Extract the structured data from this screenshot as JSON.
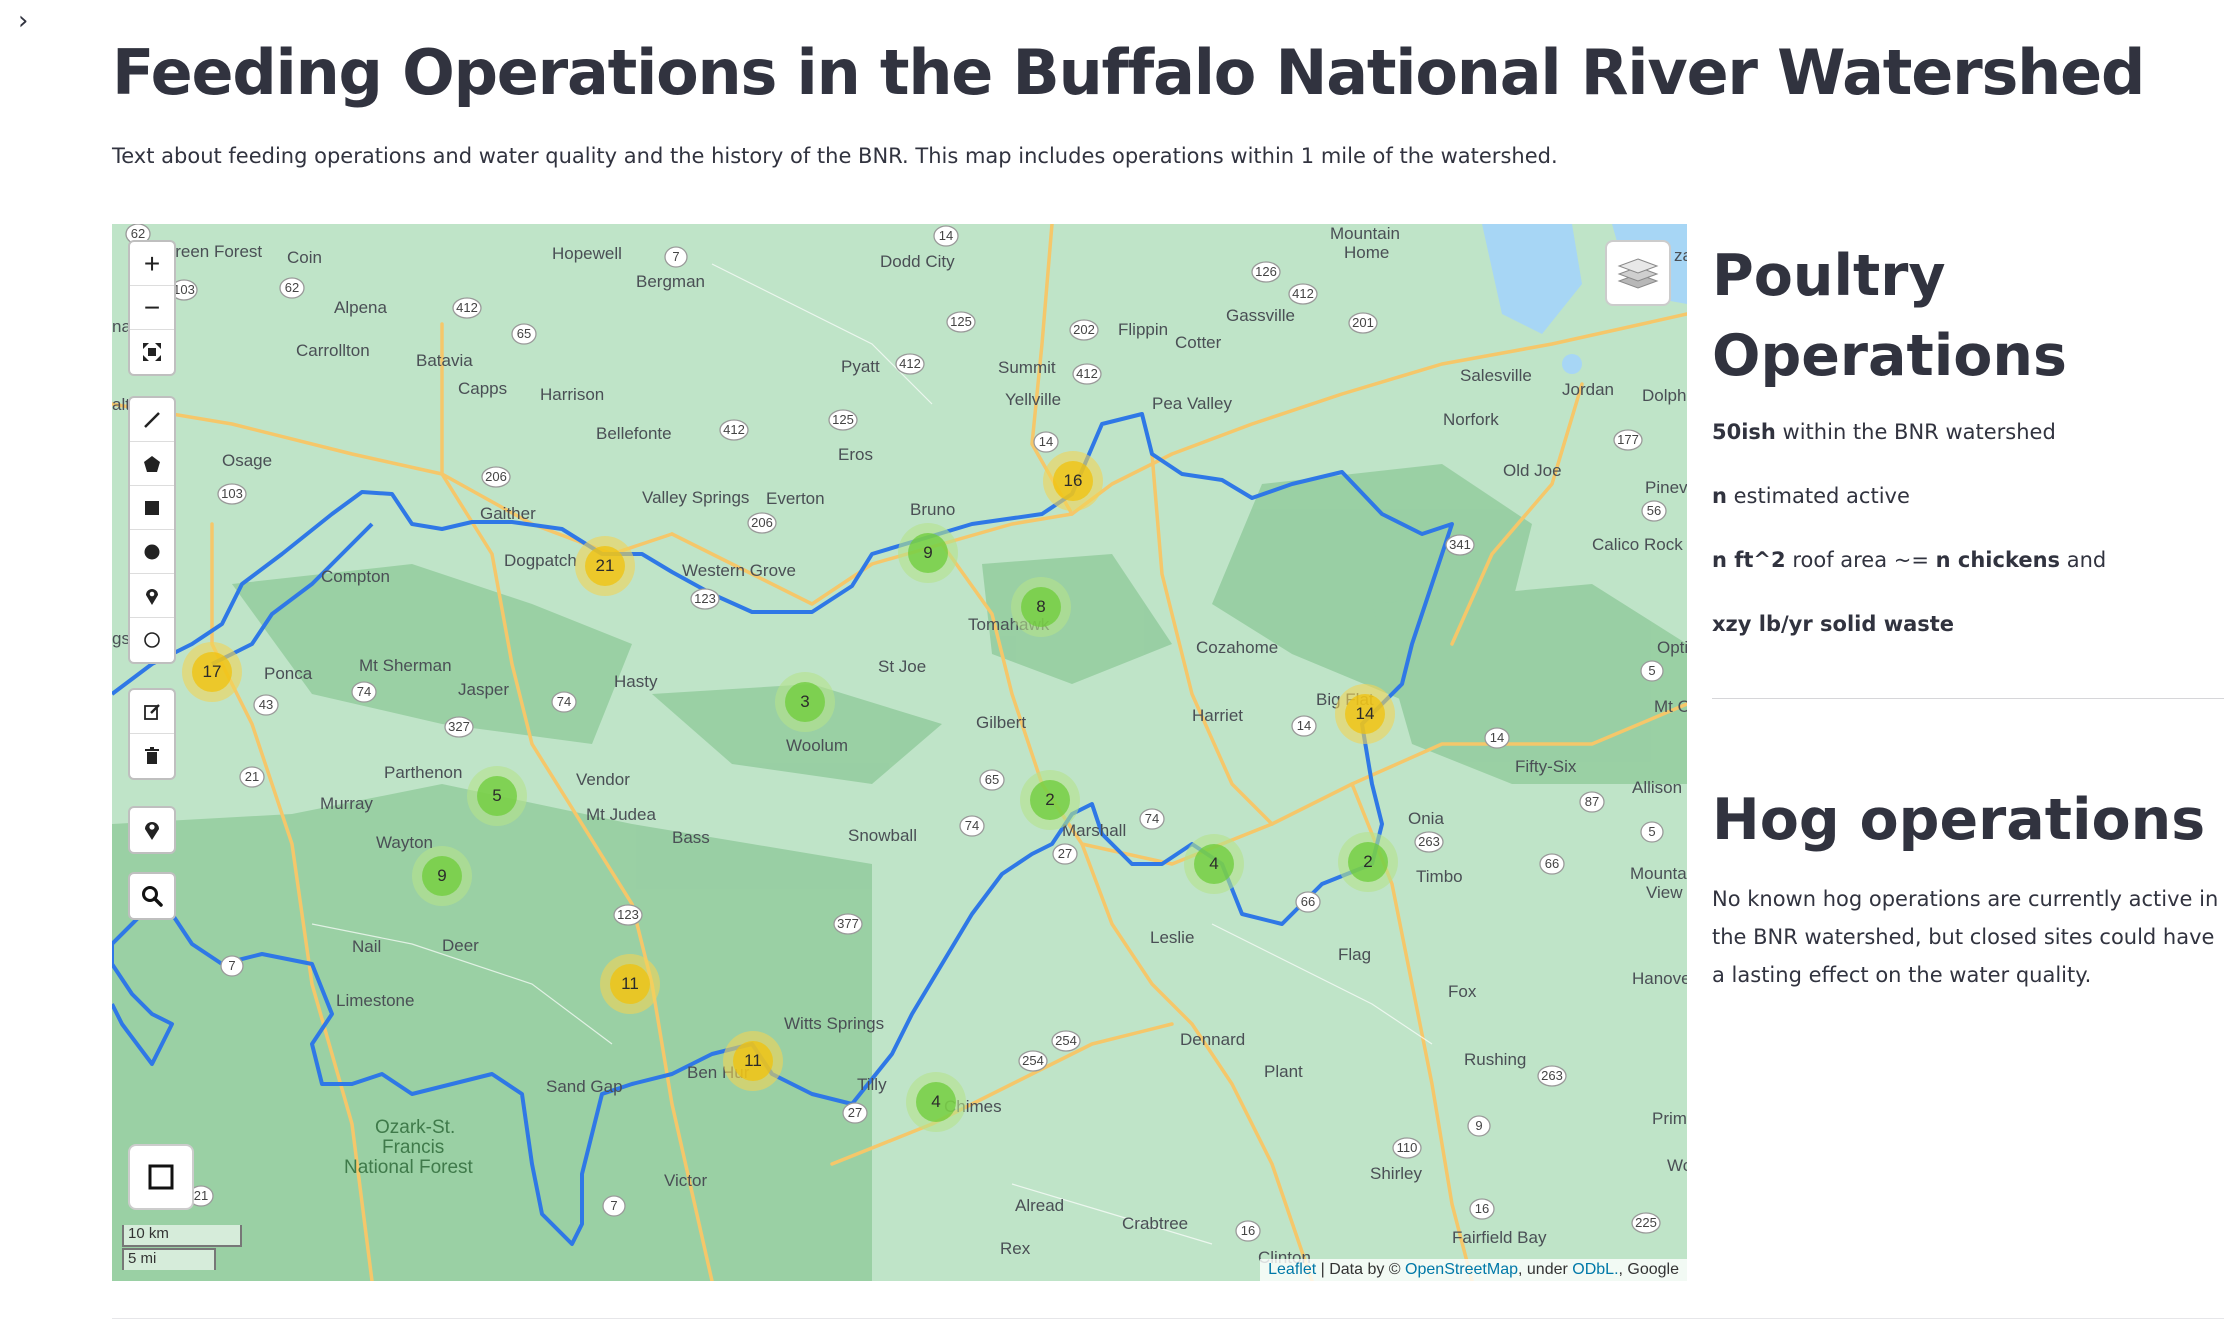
{
  "page": {
    "title": "Feeding Operations in the Buffalo National River Watershed",
    "intro": "Text about feeding operations and water quality and the history of the BNR. This map includes operations within 1 mile of the watershed."
  },
  "map": {
    "controls": {
      "zoom_in": "+",
      "zoom_out": "−",
      "draw_tools": [
        "draw-polyline",
        "draw-polygon",
        "draw-rectangle",
        "draw-circle",
        "draw-marker",
        "draw-circlemarker"
      ],
      "edit_tools": [
        "edit-layers",
        "delete-layers"
      ]
    },
    "scale": {
      "km": "10 km",
      "mi": "5 mi"
    },
    "attribution": {
      "leaflet": "Leaflet",
      "sep": " | Data by © ",
      "osm": "OpenStreetMap",
      "under": ", under ",
      "odbl": "ODbL.",
      "google": ", Google"
    },
    "clusters": [
      {
        "count": "17",
        "tier": "medium"
      },
      {
        "count": "21",
        "tier": "medium"
      },
      {
        "count": "16",
        "tier": "medium"
      },
      {
        "count": "14",
        "tier": "medium"
      },
      {
        "count": "11",
        "tier": "medium"
      },
      {
        "count": "11",
        "tier": "medium"
      },
      {
        "count": "9",
        "tier": "small"
      },
      {
        "count": "8",
        "tier": "small"
      },
      {
        "count": "3",
        "tier": "small"
      },
      {
        "count": "5",
        "tier": "small"
      },
      {
        "count": "9",
        "tier": "small"
      },
      {
        "count": "2",
        "tier": "small"
      },
      {
        "count": "4",
        "tier": "small"
      },
      {
        "count": "2",
        "tier": "small"
      },
      {
        "count": "4",
        "tier": "small"
      }
    ],
    "places": [
      "Green Forest",
      "Coin",
      "Hopewell",
      "Bergman",
      "Dodd City",
      "Mountain Home",
      "Alpena",
      "Carrollton",
      "Batavia",
      "Harrison",
      "Capps",
      "Pyatt",
      "Summit",
      "Yellville",
      "Flippin",
      "Cotter",
      "Gassville",
      "Salesville",
      "Jordan",
      "Dolph",
      "Norfork",
      "Old Joe",
      "Pineville",
      "Calico Rock",
      "Osage",
      "Bellefonte",
      "Eros",
      "Pea Valley",
      "Gaither",
      "Dogpatch",
      "Valley Springs",
      "Everton",
      "Bruno",
      "Western Grove",
      "Compton",
      "Mt Sherman",
      "Ponca",
      "Jasper",
      "Hasty",
      "Tomahawk",
      "St Joe",
      "Cozahome",
      "Harriet",
      "Big Flat",
      "Optimus",
      "Mt Olive",
      "Woolum",
      "Gilbert",
      "Fifty-Six",
      "Allison",
      "Parthenon",
      "Vendor",
      "Murray",
      "Mt Judea",
      "Bass",
      "Snowball",
      "Marshall",
      "Onia",
      "Timbo",
      "Mountain View",
      "Wayton",
      "Nail",
      "Deer",
      "Leslie",
      "Flag",
      "Hanover",
      "Limestone",
      "Fox",
      "Dennard",
      "Witts Springs",
      "Plant",
      "Rushing",
      "Sand Gap",
      "Ben Hur",
      "Tilly",
      "Chimes",
      "Primrose",
      "Shirley",
      "Victor",
      "Alread",
      "Crabtree",
      "Clinton",
      "Rex",
      "Fairfield Bay",
      "Wo"
    ],
    "forest_label": [
      "Ozark-St.",
      "Francis",
      "National Forest"
    ],
    "highways": [
      "62",
      "103",
      "62",
      "412",
      "65",
      "7",
      "14",
      "412",
      "125",
      "202",
      "412",
      "126",
      "412",
      "201",
      "125",
      "412",
      "14",
      "206",
      "103",
      "206",
      "123",
      "74",
      "43",
      "327",
      "74",
      "65",
      "74",
      "27",
      "74",
      "21",
      "123",
      "377",
      "14",
      "341",
      "5",
      "87",
      "263",
      "66",
      "5",
      "66",
      "14",
      "254",
      "254",
      "27",
      "7",
      "21",
      "7",
      "16",
      "263",
      "9",
      "110",
      "16",
      "225",
      "177",
      "56",
      "7"
    ]
  },
  "side": {
    "poultry": {
      "title_line1": "Poultry",
      "title_line2": "Operations",
      "l1_bold": "50ish",
      "l1_rest": " within the BNR watershed",
      "l2_bold": "n",
      "l2_rest": " estimated active",
      "l3_bold1": "n ft^2",
      "l3_mid": " roof area ~= ",
      "l3_bold2": "n chickens",
      "l3_rest": " and",
      "l4_bold": "xzy lb/yr solid waste"
    },
    "hog": {
      "title": "Hog operations",
      "text": "No known hog operations are currently active in the BNR watershed, but closed sites could have a lasting effect on the water quality."
    }
  },
  "colors": {
    "river": "#2f78e6",
    "water": "#a7d6f5",
    "land": "#bfe4c8",
    "forest": "#93cc9e",
    "road": "#f5c76a"
  }
}
